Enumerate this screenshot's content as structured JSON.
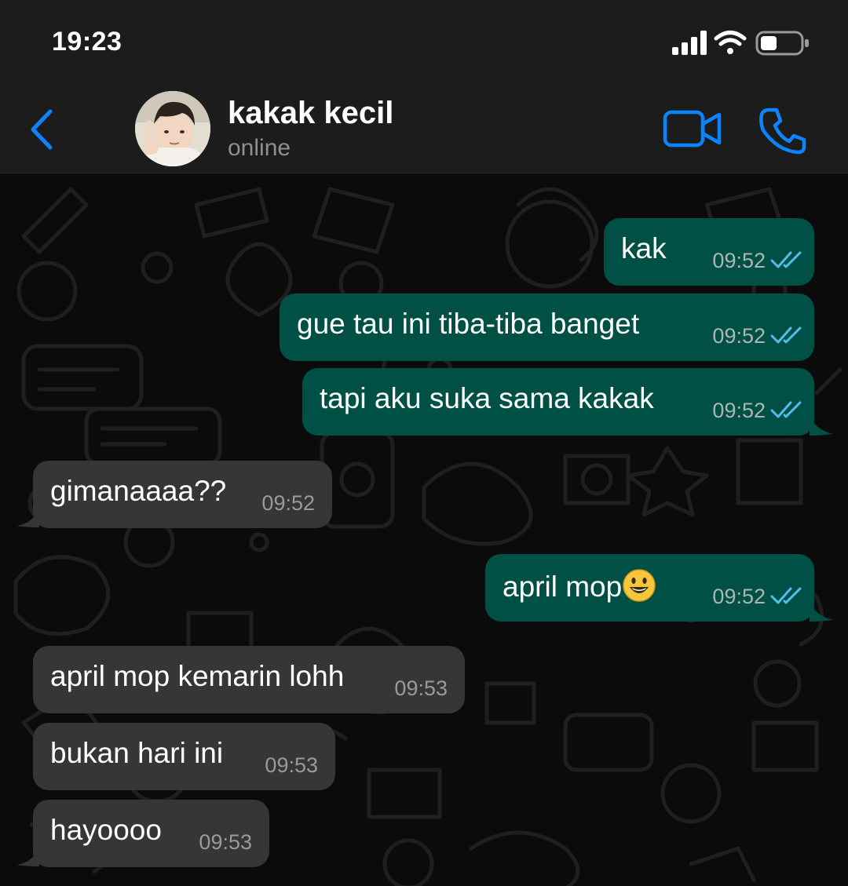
{
  "status_bar": {
    "time": "19:23",
    "icons": [
      "signal-bars-icon",
      "wifi-icon",
      "battery-icon"
    ]
  },
  "header": {
    "contact_name": "kakak kecil",
    "contact_status": "online",
    "back_icon": "chevron-left-icon",
    "video_icon": "video-camera-icon",
    "phone_icon": "phone-icon"
  },
  "colors": {
    "accent": "#0a84ff",
    "outgoing_bubble": "#005046",
    "incoming_bubble": "#363638",
    "read_ticks": "#53bdeb"
  },
  "messages": [
    {
      "direction": "outgoing",
      "text": "kak",
      "time": "09:52",
      "status": "read"
    },
    {
      "direction": "outgoing",
      "text": "gue tau ini tiba-tiba banget",
      "time": "09:52",
      "status": "read"
    },
    {
      "direction": "outgoing",
      "text": "tapi aku suka sama kakak",
      "time": "09:52",
      "status": "read"
    },
    {
      "direction": "incoming",
      "text": "gimanaaaa??",
      "time": "09:52"
    },
    {
      "direction": "outgoing",
      "text": "april mop",
      "emoji": "grinning-face-emoji",
      "time": "09:52",
      "status": "read"
    },
    {
      "direction": "incoming",
      "text": "april mop kemarin lohh",
      "time": "09:53"
    },
    {
      "direction": "incoming",
      "text": "bukan hari ini",
      "time": "09:53"
    },
    {
      "direction": "incoming",
      "text": "hayoooo",
      "time": "09:53"
    }
  ]
}
